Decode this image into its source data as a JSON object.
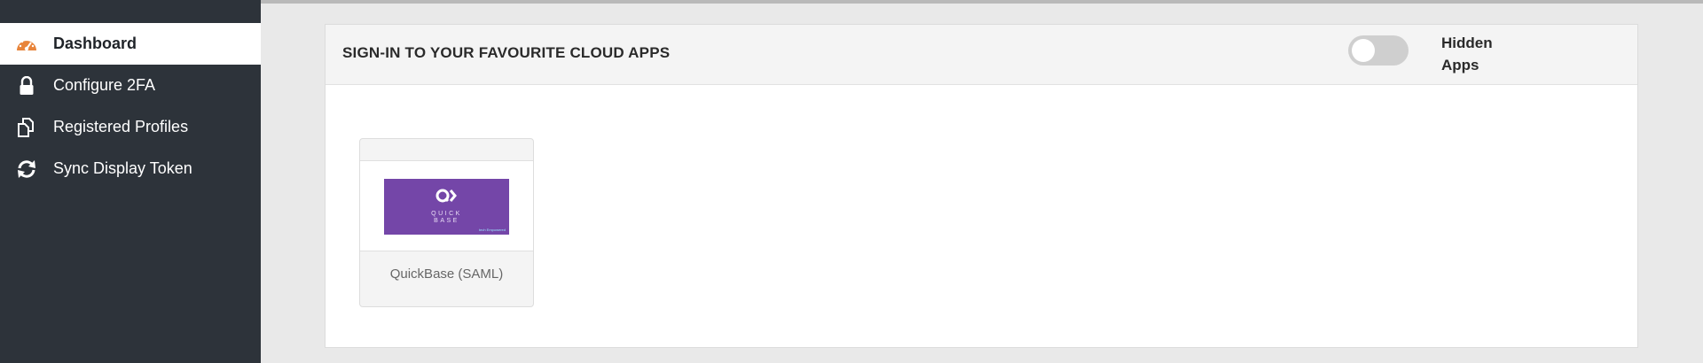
{
  "sidebar": {
    "items": [
      {
        "label": "Dashboard",
        "icon": "dashboard-gauge-icon",
        "active": true
      },
      {
        "label": "Configure 2FA",
        "icon": "lock-icon",
        "active": false
      },
      {
        "label": "Registered Profiles",
        "icon": "copy-profiles-icon",
        "active": false
      },
      {
        "label": "Sync Display Token",
        "icon": "sync-icon",
        "active": false
      }
    ]
  },
  "panel": {
    "title": "SIGN-IN TO YOUR FAVOURITE CLOUD APPS",
    "toggle_label_line1": "Hidden",
    "toggle_label_line2": "Apps",
    "toggle_on": false
  },
  "apps": [
    {
      "name": "QuickBase (SAML)",
      "logo_text_line1": "QUICK",
      "logo_text_line2": "BASE",
      "logo_badge": "tech Empowered",
      "logo_color": "#7446a8"
    }
  ],
  "colors": {
    "sidebar_bg": "#2d333a",
    "page_bg": "#e9e9e9",
    "accent_orange": "#e8843a"
  }
}
